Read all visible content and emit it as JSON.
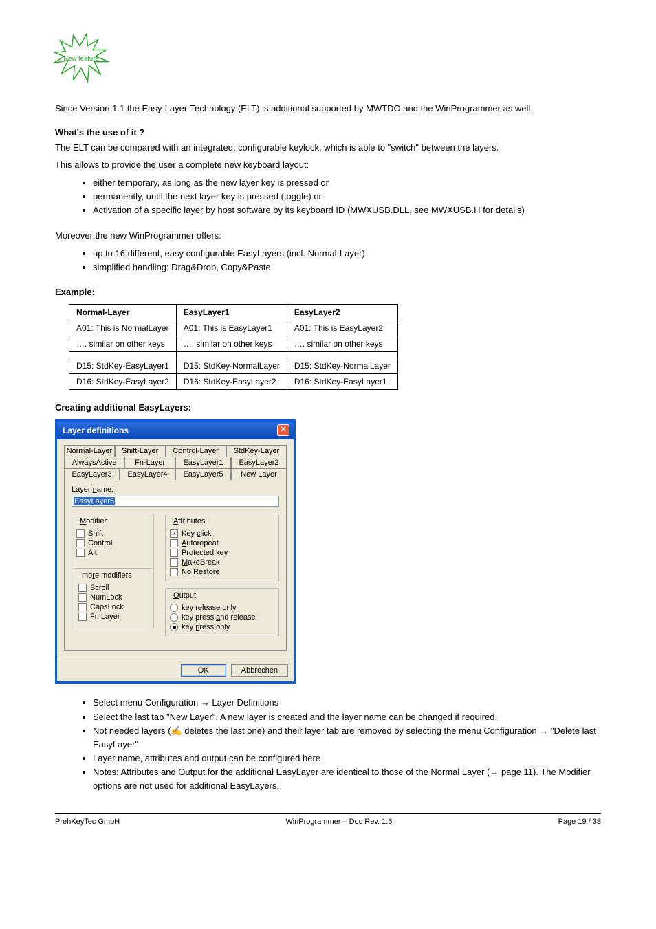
{
  "starburst_label": "New feature",
  "intro": "Since Version 1.1 the Easy-Layer-Technology (ELT) is additional supported by MWTDO and the WinProgrammer as well.",
  "section1_title": "What's the use of it ?",
  "section1_body": "The ELT can be compared with an integrated, configurable keylock, which is able to \"switch\" between the layers.",
  "section1_bullets_intro": "This allows to provide the user a complete new keyboard layout:",
  "section1_bullets": [
    "either temporary, as long as the new layer key is pressed or",
    "permanently, until the next layer key is pressed (toggle) or",
    "Activation of a specific layer by host software by its keyboard ID (MWXUSB.DLL, see MWXUSB.H for details)"
  ],
  "section1_bullets2_intro": "Moreover the new WinProgrammer offers:",
  "section1_bullets2": [
    "up to 16 different, easy configurable EasyLayers (incl. Normal-Layer)",
    "simplified handling: Drag&Drop, Copy&Paste"
  ],
  "section_example_title": "Example:",
  "table": {
    "headers": [
      "Normal-Layer",
      "EasyLayer1",
      "EasyLayer2"
    ],
    "rows": [
      [
        "A01: This is NormalLayer",
        "A01: This is EasyLayer1",
        "A01: This is EasyLayer2"
      ],
      [
        "…. similar on other keys",
        "…. similar on other keys",
        "…. similar on other keys"
      ],
      [
        "",
        "",
        ""
      ],
      [
        "D15: StdKey-EasyLayer1",
        "D15: StdKey-NormalLayer",
        "D15: StdKey-NormalLayer"
      ],
      [
        "D16: StdKey-EasyLayer2",
        "D16: StdKey-EasyLayer2",
        "D16: StdKey-EasyLayer1"
      ]
    ]
  },
  "creating_title": "Creating additional EasyLayers:",
  "dialog": {
    "title": "Layer definitions",
    "tabs_row1": [
      "Normal-Layer",
      "Shift-Layer",
      "Control-Layer",
      "StdKey-Layer"
    ],
    "tabs_row2": [
      "AlwaysActive",
      "Fn-Layer",
      "EasyLayer1",
      "EasyLayer2"
    ],
    "tabs_row3": [
      "EasyLayer3",
      "EasyLayer4",
      "EasyLayer5",
      "New Layer"
    ],
    "layer_name_label": "Layer name:",
    "layer_name_value": "EasyLayer5",
    "modifier_label": "Modifier",
    "modifiers": [
      "Shift",
      "Control",
      "Alt"
    ],
    "more_modifiers_label": "more modifiers",
    "more_modifiers": [
      "Scroll",
      "NumLock",
      "CapsLock",
      "Fn Layer"
    ],
    "attributes_label": "Attributes",
    "attributes": [
      {
        "label": "Key click",
        "checked": true
      },
      {
        "label": "Autorepeat",
        "checked": false
      },
      {
        "label": "Protected key",
        "checked": false
      },
      {
        "label": "MakeBreak",
        "checked": false
      },
      {
        "label": "No Restore",
        "checked": false
      }
    ],
    "output_label": "Output",
    "outputs": [
      {
        "label": "key release only",
        "checked": false
      },
      {
        "label": "key press and release",
        "checked": false
      },
      {
        "label": "key press only",
        "checked": true
      }
    ],
    "ok": "OK",
    "cancel": "Abbrechen"
  },
  "creating_bullets": [
    {
      "text": "Select menu Configuration → Layer Definitions"
    },
    {
      "text": "Select the last tab \"New Layer\". A new layer is created and the layer name can be changed if required."
    },
    {
      "text": "Not needed layers (",
      "icon": true,
      "text2": " deletes the last one) and their layer tab are removed by selecting the menu Configuration → \"Delete last EasyLayer\""
    },
    {
      "text": "Layer name, attributes and output can be configured here"
    },
    {
      "text": "Notes: Attributes and Output for the additional EasyLayer are identical to those of the Normal Layer (→ page 11). The Modifier options are not used for additional EasyLayers."
    }
  ],
  "footer": {
    "left": "PrehKeyTec GmbH",
    "center": "WinProgrammer – Doc Rev. 1.6",
    "right": "Page 19 / 33"
  }
}
